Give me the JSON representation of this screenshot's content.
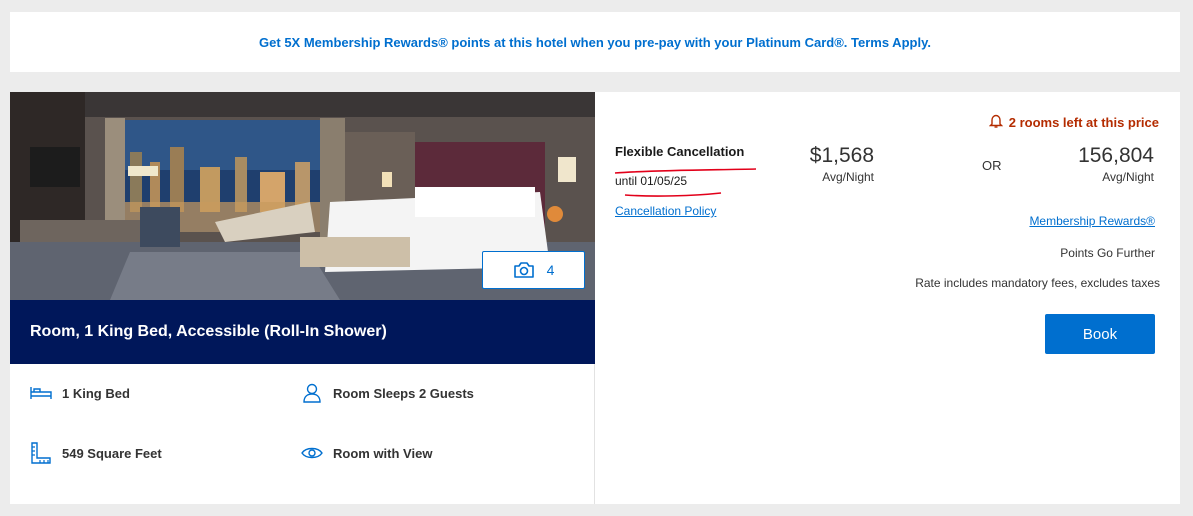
{
  "promo": {
    "text": "Get 5X Membership Rewards® points at this hotel when you pre-pay with your Platinum Card®. Terms Apply."
  },
  "room": {
    "photo_count": "4",
    "title": "Room, 1 King Bed, Accessible (Roll-In Shower)",
    "features": [
      {
        "icon": "bed-icon",
        "label": "1 King Bed"
      },
      {
        "icon": "person-icon",
        "label": "Room Sleeps 2 Guests"
      },
      {
        "icon": "ruler-icon",
        "label": "549 Square Feet"
      },
      {
        "icon": "eye-icon",
        "label": "Room with View"
      }
    ]
  },
  "rate": {
    "rooms_left": "2 rooms left at this price",
    "cancellation_title": "Flexible Cancellation",
    "cancellation_until": "until 01/05/25",
    "cancellation_policy": "Cancellation Policy",
    "cash_price": "$1,568",
    "cash_sub": "Avg/Night",
    "or": "OR",
    "points_price": "156,804",
    "points_sub": "Avg/Night",
    "mr_link": "Membership Rewards®",
    "go_further": "Points Go Further",
    "rate_note": "Rate includes mandatory fees, excludes taxes",
    "book": "Book"
  },
  "colors": {
    "brand_blue": "#006fcf",
    "navy": "#00175a",
    "alert": "#b42c01",
    "annotation_red": "#e2001a"
  }
}
